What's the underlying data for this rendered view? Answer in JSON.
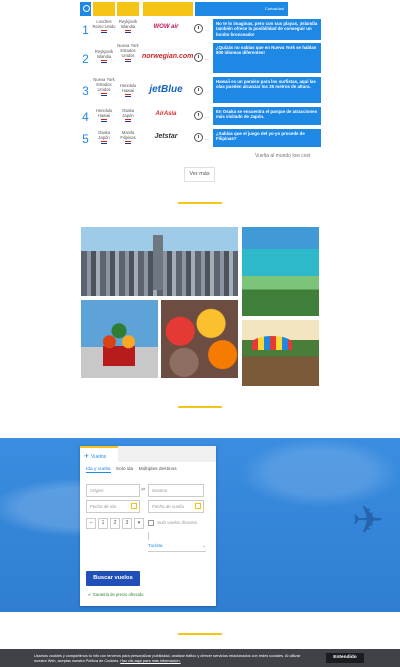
{
  "table": {
    "header_caption": "Curiosidad",
    "rows": [
      {
        "num": "1",
        "from": "Londres Reino Unido",
        "to": "Reykjavík Islandia",
        "airline": "WOW air",
        "fact": "No te lo imaginas, pero con sus playas, ¡Islandia también ofrece la posibilidad de conseguir un bonito bronceado!"
      },
      {
        "num": "2",
        "from": "Reykjavík Islandia",
        "to": "Nueva York Estados Unidos",
        "airline": "norwegian.com",
        "fact": "¿Quizás no sabías que en Nueva York se hablan 800 idiomas diferentes!"
      },
      {
        "num": "3",
        "from": "Nueva York Estados Unidos",
        "to": "Honolulu Hawaii",
        "airline": "jetBlue",
        "fact": "Hawaii es un paraíso para los surfistas, aquí las olas pueden alcanzar los 25 metros de altura."
      },
      {
        "num": "4",
        "from": "Honolulu Hawaii",
        "to": "Osaka Japón",
        "airline": "AirAsia",
        "fact": "En Osaka se encuentra el parque de atracciones más visitado de Japón."
      },
      {
        "num": "5",
        "from": "Osaka Japón",
        "to": "Manila Filipinas",
        "airline": "Jetstar",
        "fact": "¿Sabías que el juego del yo-yo procede de Filipinas?"
      }
    ],
    "caption": "Vuelta al mundo low cost",
    "more_button": "Ver más"
  },
  "photos": [
    "new-york-skyline",
    "tropical-beach",
    "moscow-cathedral",
    "spice-market",
    "street-market"
  ],
  "search": {
    "tab_label": "Vuelos",
    "trip_types": [
      "Ida y vuelta",
      "Solo ida",
      "Múltiples destinos"
    ],
    "origin_placeholder": "Origen",
    "destination_placeholder": "Destino",
    "depart_placeholder": "Fecha de ida",
    "return_placeholder": "Fecha de vuelta",
    "passengers": [
      "–",
      "1",
      "2",
      "3",
      "▾"
    ],
    "direct_only": "Solo vuelos directos",
    "cabin_class": "Turista",
    "submit": "Buscar vuelos",
    "note": "✔ Garantía de precio ofrecido"
  },
  "cookies": {
    "text": "Usamos cookies y compartimos tu info con terceros para personalizar publicidad, analizar tráfico y ofrecer servicios relacionados con redes sociales. Al utilizar nuestra Web, aceptas nuestra Política de Cookies.",
    "link": "Haz clic aquí para más información.",
    "button": "Entendido"
  },
  "colors": {
    "brand_blue": "#1e88e5",
    "accent_yellow": "#f6c416",
    "button_navy": "#1f4fb7"
  }
}
